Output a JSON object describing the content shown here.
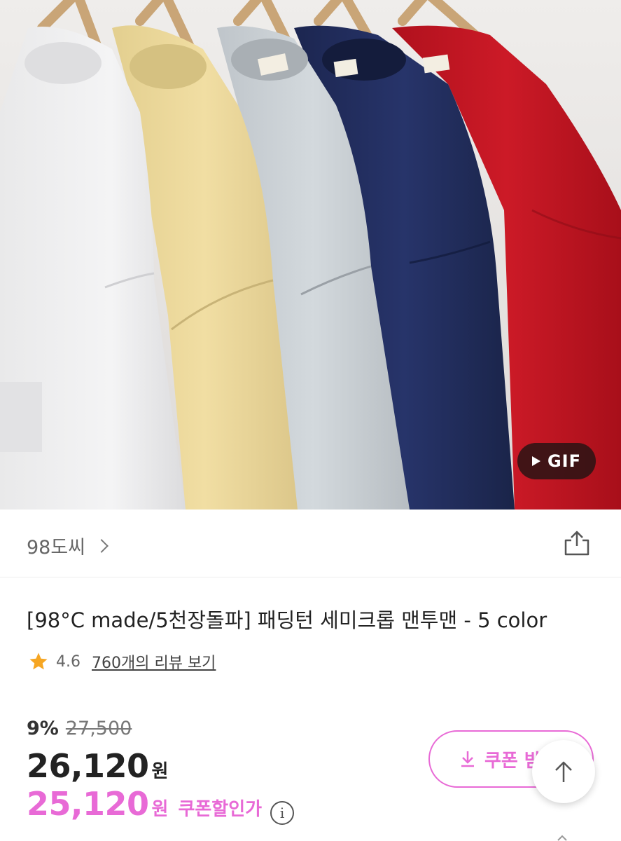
{
  "hero": {
    "gif_label": "GIF"
  },
  "store": {
    "name": "98도씨"
  },
  "product": {
    "title": "[98°C made/5천장돌파] 패딩턴 세미크롭 맨투맨 - 5 color",
    "rating": "4.6",
    "reviews_link": "760개의 리뷰 보기"
  },
  "price": {
    "discount_percent": "9%",
    "original": "27,500",
    "sale": "26,120",
    "sale_unit": "원",
    "coupon_price": "25,120",
    "coupon_unit": "원",
    "coupon_label": "쿠폰할인가",
    "info_glyph": "i"
  },
  "coupon_button": {
    "label": "쿠폰 받"
  },
  "colors": {
    "accent": "#e86ad6",
    "star": "#f6a623"
  }
}
